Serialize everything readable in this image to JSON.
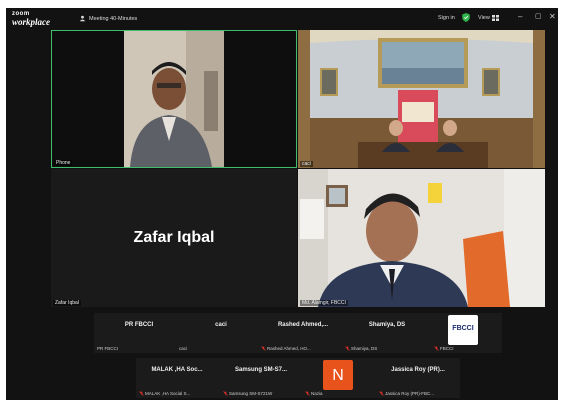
{
  "app": {
    "logo_line1": "zoom",
    "logo_line2": "workplace",
    "meeting_title": "Meeting 40-Minutes",
    "sign_in": "Sign in",
    "view": "View"
  },
  "tiles": [
    {
      "label": "Phone"
    },
    {
      "label": "caci"
    },
    {
      "label": "Zafar Iqbal",
      "display_name": "Zafar Iqbal"
    },
    {
      "label": "Md. Alamgir, FBCCI"
    }
  ],
  "strip_row1": [
    {
      "name": "PR FBCCI",
      "label": "PR FBCCI",
      "muted": false
    },
    {
      "name": "caci",
      "label": "caci",
      "muted": false
    },
    {
      "name": "Rashed Ahmed,...",
      "label": "Rashed Ahmed, HO...",
      "muted": true
    },
    {
      "name": "Shamiya, DS",
      "label": "Shamiya, DS",
      "muted": true
    },
    {
      "name": "",
      "label": "FBCCI",
      "muted": true,
      "logo_text": "FBCCI"
    }
  ],
  "strip_row2": [
    {
      "name": "MALAK ,HA Soc...",
      "label": "MALAK ,HA Social S...",
      "muted": true
    },
    {
      "name": "Samsung SM-S7...",
      "label": "Samsung SM-S721W",
      "muted": true
    },
    {
      "name": "",
      "label": "Nazia",
      "muted": true,
      "initial": "N"
    },
    {
      "name": "Jassica Roy (PR)...",
      "label": "Jassica Roy (PR)-FBC...",
      "muted": true
    }
  ],
  "colors": {
    "window_bg": "#121212",
    "active_speaker_border": "#3fbf6b",
    "mute_red": "#e0302a",
    "avatar_orange": "#e8531c",
    "shield_green": "#2fb34a"
  },
  "icons": [
    "meeting-icon",
    "shield-icon",
    "view-grid-icon",
    "minimize-icon",
    "maximize-icon",
    "close-icon",
    "mic-muted-icon"
  ]
}
